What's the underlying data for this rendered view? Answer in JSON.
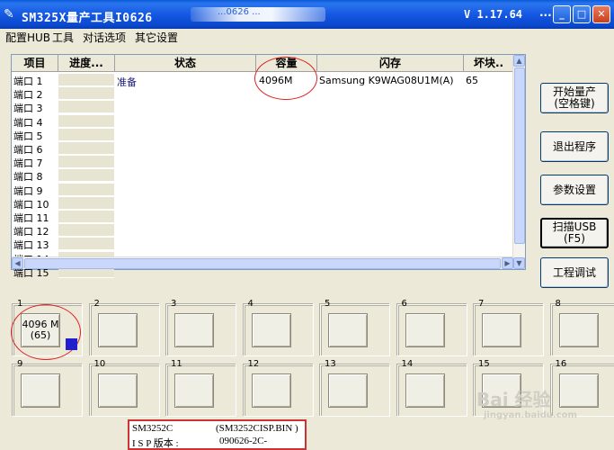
{
  "window": {
    "title": "SM325X量产工具I0626",
    "title_blurred": "...0626 ...",
    "version": "V 1.17.64",
    "title_dots": "...",
    "buttons": {
      "minimize": "_",
      "maximize": "□",
      "close": "✕"
    }
  },
  "menu": [
    "配置HUB",
    "工具",
    "对话选项",
    "其它设置"
  ],
  "grid": {
    "columns": [
      "项目",
      "进度...",
      "状态",
      "容量",
      "闪存",
      "坏块.."
    ],
    "rows": [
      {
        "port": "端口 1",
        "status": "准备",
        "capacity": "4096M",
        "flash": "Samsung K9WAG08U1M(A)",
        "bad": "65"
      },
      {
        "port": "端口 2"
      },
      {
        "port": "端口 3"
      },
      {
        "port": "端口 4"
      },
      {
        "port": "端口 5"
      },
      {
        "port": "端口 6"
      },
      {
        "port": "端口 7"
      },
      {
        "port": "端口 8"
      },
      {
        "port": "端口 9"
      },
      {
        "port": "端口 10"
      },
      {
        "port": "端口 11"
      },
      {
        "port": "端口 12"
      },
      {
        "port": "端口 13"
      },
      {
        "port": "端口 14"
      },
      {
        "port": "端口 15"
      }
    ]
  },
  "side_buttons": [
    {
      "line1": "开始量产",
      "line2": "(空格键)"
    },
    {
      "line1": "退出程序",
      "line2": ""
    },
    {
      "line1": "参数设置",
      "line2": ""
    },
    {
      "line1": "扫描USB",
      "line2": "(F5)"
    },
    {
      "line1": "工程调试",
      "line2": ""
    }
  ],
  "ports": [
    {
      "num": "1",
      "line1": "4096 M",
      "line2": "(65)"
    },
    {
      "num": "2"
    },
    {
      "num": "3"
    },
    {
      "num": "4"
    },
    {
      "num": "5"
    },
    {
      "num": "6"
    },
    {
      "num": "7"
    },
    {
      "num": "8"
    },
    {
      "num": "9"
    },
    {
      "num": "10"
    },
    {
      "num": "11"
    },
    {
      "num": "12"
    },
    {
      "num": "13"
    },
    {
      "num": "14"
    },
    {
      "num": "15"
    },
    {
      "num": "16"
    }
  ],
  "info": {
    "line1_left": "SM3252C",
    "line1_right": "(SM3252CISP.BIN )",
    "line2_left": "I S P 版本 :",
    "line2_right": "090626-2C-"
  },
  "watermark": {
    "logo": "Bai 经验",
    "url": "jingyan.baidu.com"
  },
  "colors": {
    "titlebar": "#1558e2",
    "led": "#1f1fd0",
    "highlight": "#cc3333"
  }
}
